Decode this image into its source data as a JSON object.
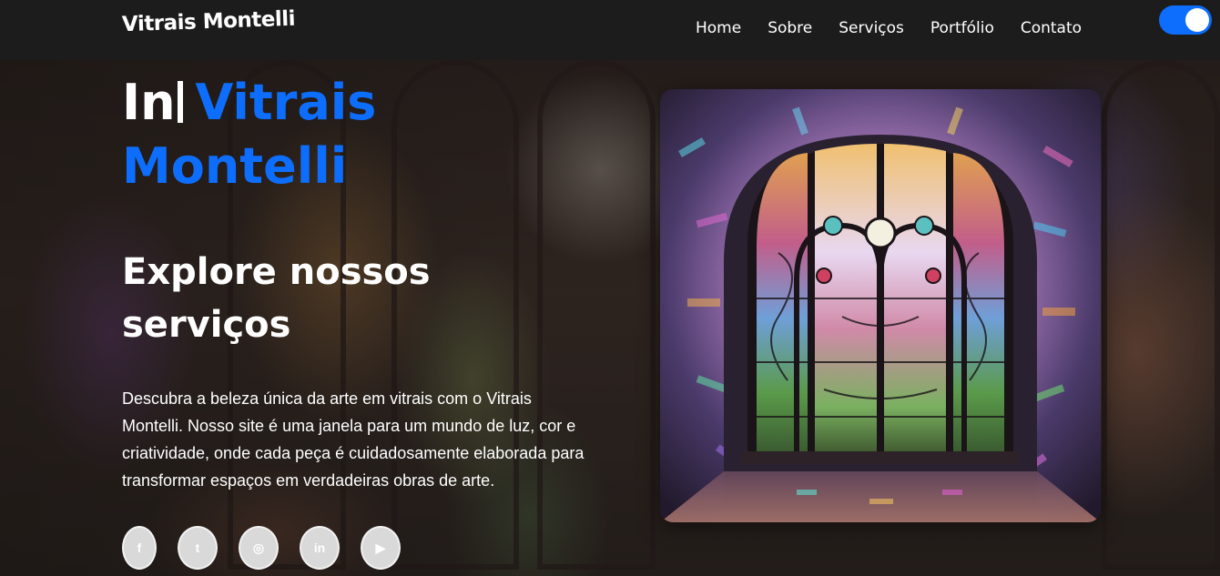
{
  "header": {
    "logo": "Vitrais Montelli",
    "nav": [
      {
        "label": "Home"
      },
      {
        "label": "Sobre"
      },
      {
        "label": "Serviços"
      },
      {
        "label": "Portfólio"
      },
      {
        "label": "Contato"
      }
    ],
    "theme_toggle": {
      "on": true,
      "color": "#0d6efd"
    }
  },
  "hero": {
    "title_prefix": "In",
    "title_accent": "Vitrais Montelli",
    "subtitle": "Explore nossos serviços",
    "description": "Descubra a beleza única da arte em vitrais com o Vitrais Montelli. Nosso site é uma janela para um mundo de luz, cor e criatividade, onde cada peça é cuidadosamente elaborada para transformar espaços em verdadeiras obras de arte.",
    "socials": [
      {
        "icon": "facebook-icon",
        "glyph": "f"
      },
      {
        "icon": "twitter-icon",
        "glyph": "t"
      },
      {
        "icon": "instagram-icon",
        "glyph": "◎"
      },
      {
        "icon": "linkedin-icon",
        "glyph": "in"
      },
      {
        "icon": "youtube-icon",
        "glyph": "▶"
      }
    ]
  },
  "colors": {
    "accent": "#0d6efd",
    "header_bg": "#1c1c1c",
    "social_bg": "#d9d9d9"
  }
}
